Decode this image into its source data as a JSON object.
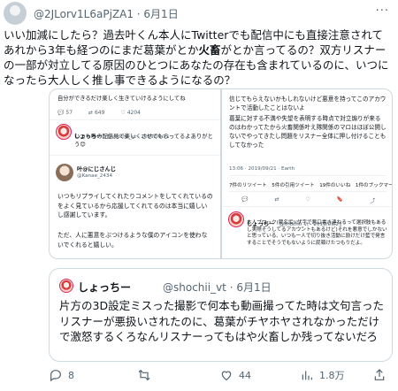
{
  "tweet": {
    "handle": "@2JLorv1L6aPjZA1",
    "date_sep": " · ",
    "date": "6月1日",
    "more_label": "···",
    "body_1": "いい加減にしたら？過去叶くん本人にTwitterでも配信中にも直接注意されてあれから3年も経つのにまだ葛葉がとか",
    "body_bold": "火畜",
    "body_2": "がとか言ってるの？双方リスナーの一部が対立してる原因のひとつにあなたの存在も含まれているのに、いつになったら大人しく推し事できるようになるの？"
  },
  "screenshot_left": {
    "top_text": "自分ができるだけ楽しく生きていけるようにしてね",
    "stats": [
      "57",
      "649",
      "4204"
    ],
    "reply_name": "しょっちー",
    "reply_meta": "@shochii_vt · 2019/09/21",
    "reply_text": "いつも叶の配信見て楽しくさせてもらってるよありがとう😊",
    "kanae_name": "叶@にじさんじ",
    "kanae_handle": "@Kanae_2434",
    "kanae_text_1": "いつもリプライしてくれたりコメントをしてくれているのをよく見ているから応援してくれてるのは本当に嬉しいし感謝しています。",
    "kanae_text_2": "ただ、人に悪意をぶつけるような僕のアイコンを使わないでくれると嬉しい。"
  },
  "screenshot_right": {
    "text_1": "信じてもらえないかもしれないけど悪意を持ってこのアカウントで活動したことはないよ",
    "text_2": "葛葉に対する不満や失望を表明する時点で対立煽りが来るのはわかってたから火畜関係叶え隊関係のマロはほぼ公開しないでやってきたし問題をリスナー全体に押し付けることもしてなかった",
    "meta": "13:06 · 2019/09/21 · Earth",
    "counts": "7件のリツイート　5件の引用ツイート　19件のいいね　1件のブックマーク",
    "reply_name": "しょっちー",
    "reply_meta": "@shochii_vt · 2019/09/21",
    "reply_text": "本人ブロック(蔵名垢)(伏字で悪口書き連ねるって選択肢もあるし実際そうしてるアカウントもあるけど)それを悪意でしかないと思っている、いつも一人で切り抜き活動に励けだけ藍で発言することでそうでもないように屁頓けたつもりだよ。"
  },
  "quote": {
    "name": "しょっちー",
    "handle": "@shochii_vt",
    "sep": " · ",
    "date": "6月1日",
    "text": "片方の3D設定ミスった撮影で何本も動画撮ってた時は文句言ったリスナーが悪扱いされたのに、葛葉がチヤホヤされなかっただけで激怒するくろなんリスナーってもはや火畜しか残ってないだろ"
  },
  "actions": {
    "replies": "8",
    "retweets": "",
    "likes": "44",
    "views": "1.8万"
  },
  "colors": {
    "text": "#0f1419",
    "secondary": "#536471",
    "border": "#cfd9de"
  }
}
